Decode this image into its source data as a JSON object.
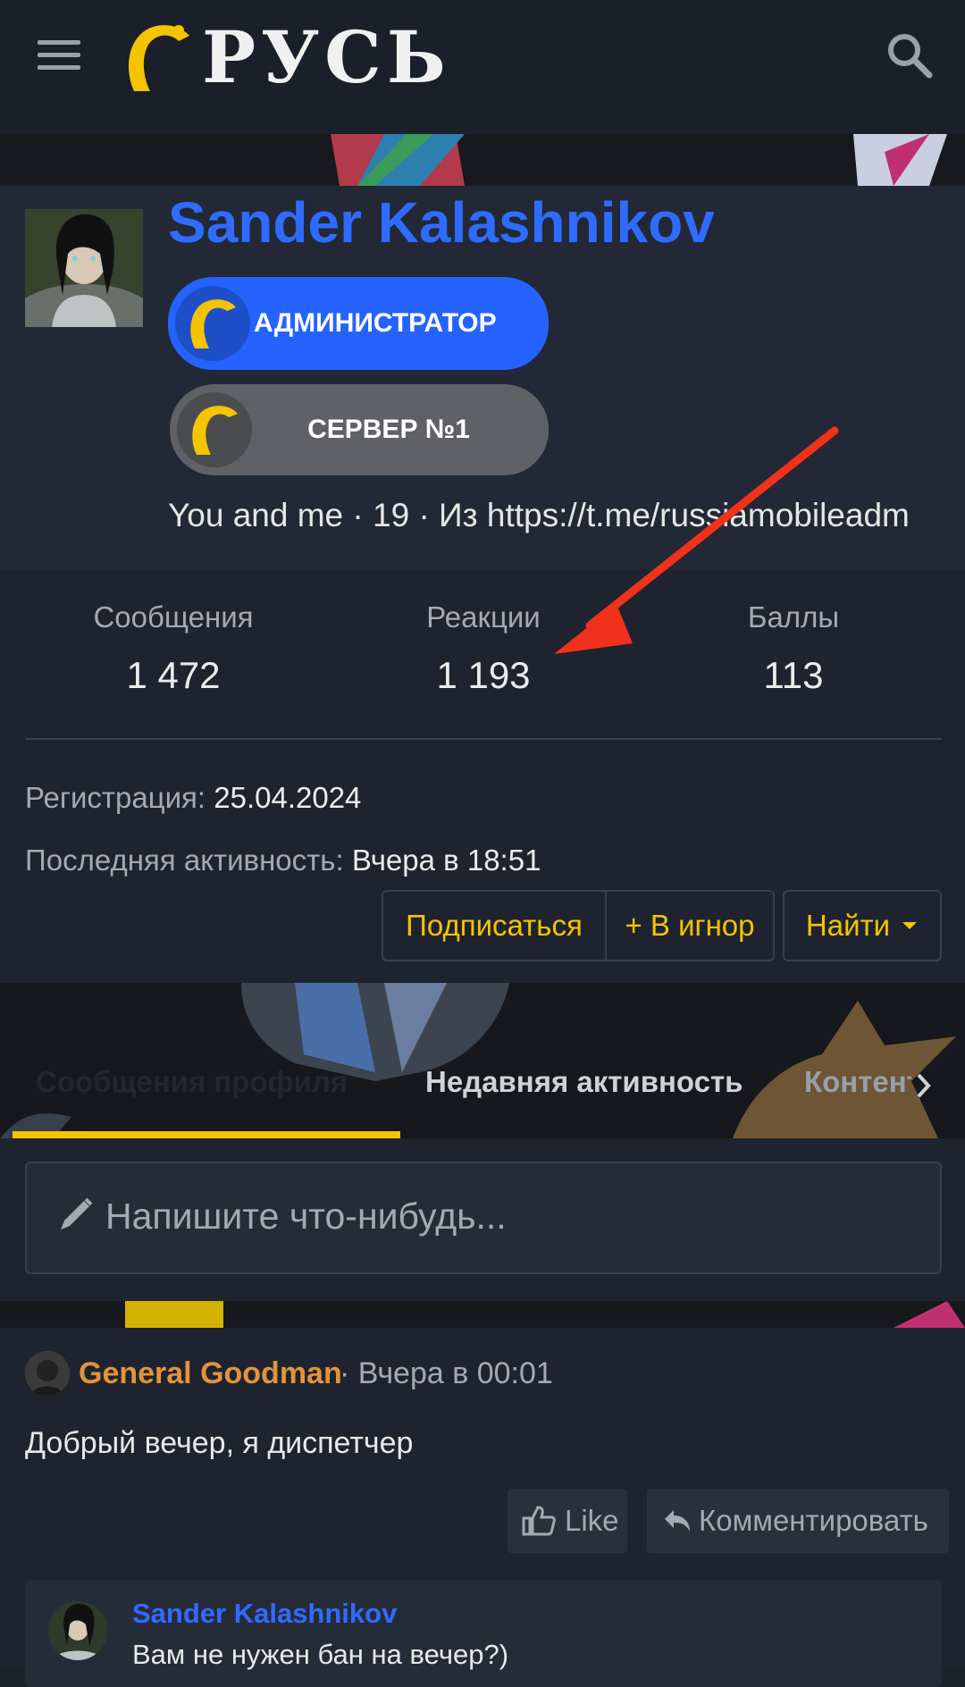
{
  "header": {
    "logo_text": "РУСЬ"
  },
  "profile": {
    "name": "Sander Kalashnikov",
    "badges": [
      {
        "label": "АДМИНИСТРАТОР",
        "color": "#2563ff"
      },
      {
        "label": "СЕРВЕР №1",
        "color": "#5f6166"
      }
    ],
    "info": "You and me · 19 · Из https://t.me/russiamobileadm"
  },
  "stats": [
    {
      "label": "Сообщения",
      "value": "1 472"
    },
    {
      "label": "Реакции",
      "value": "1 193"
    },
    {
      "label": "Баллы",
      "value": "113"
    }
  ],
  "meta": {
    "registration_label": "Регистрация:",
    "registration_value": "25.04.2024",
    "last_activity_label": "Последняя активность:",
    "last_activity_value": "Вчера в 18:51"
  },
  "actions": {
    "subscribe": "Подписаться",
    "ignore": "+ В игнор",
    "find": "Найти"
  },
  "tabs": [
    {
      "label": "Сообщения профиля",
      "active": true
    },
    {
      "label": "Недавняя активность",
      "active": false
    },
    {
      "label": "Контент",
      "active": false
    }
  ],
  "composer": {
    "placeholder": "Напишите что-нибудь..."
  },
  "post": {
    "author": "General Goodman",
    "time": "· Вчера в 00:01",
    "text": "Добрый вечер, я диспетчер",
    "like_label": "Like",
    "comment_label": "Комментировать",
    "reply": {
      "author": "Sander Kalashnikov",
      "text": "Вам не нужен бан на вечер?)"
    }
  },
  "colors": {
    "accent": "#f5c400",
    "name_blue": "#2f6bff",
    "author_orange": "#e0953a",
    "annotation_red": "#f0321a"
  }
}
